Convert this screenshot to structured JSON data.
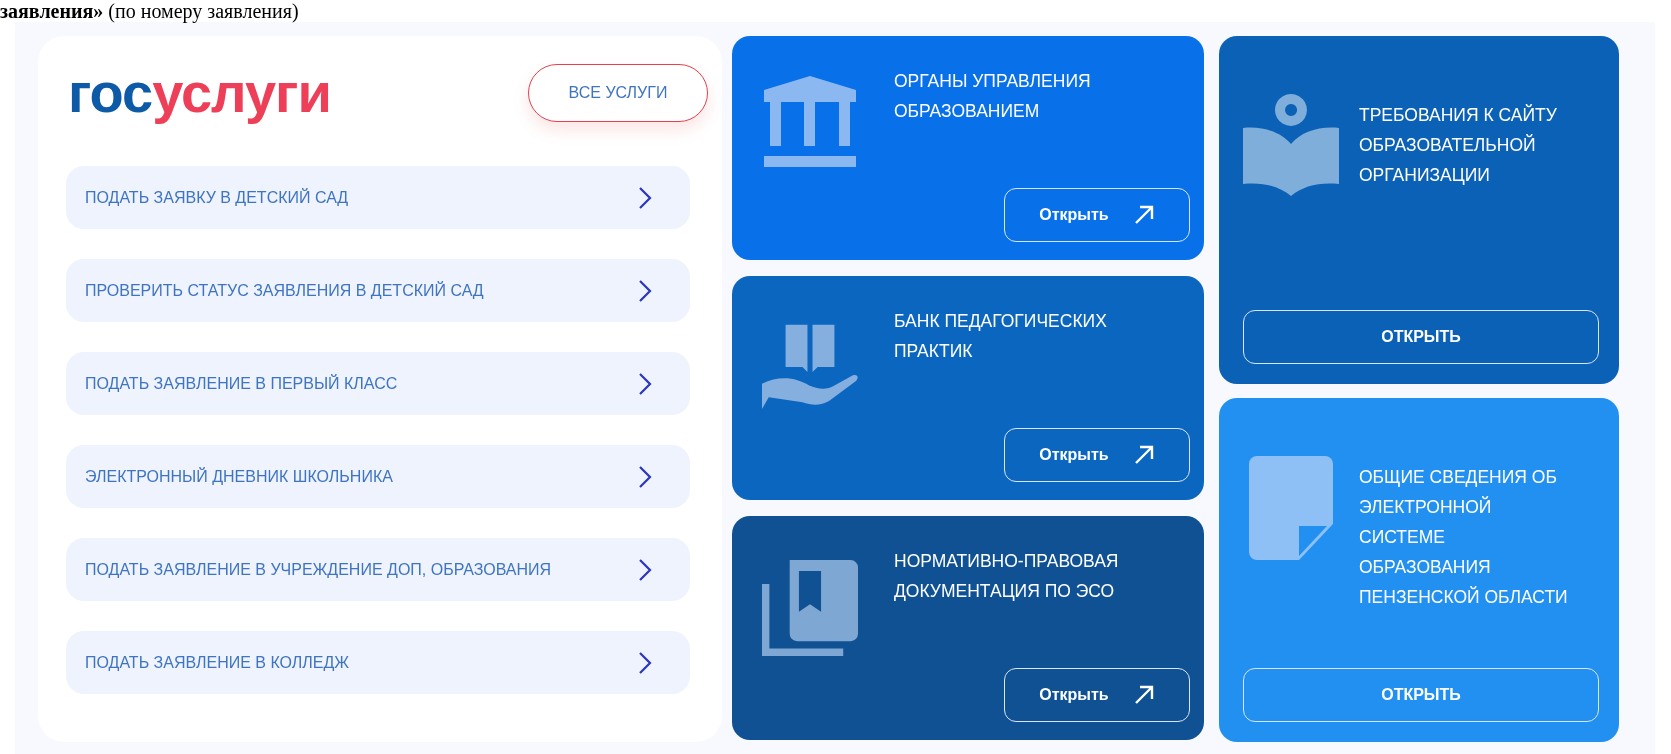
{
  "heading": "**заявления»** (по номеру заявления)",
  "logo": {
    "parts": [
      {
        "text": "гос",
        "color": "#0d5aa7"
      },
      {
        "text": "услуги",
        "color": "#ee3f58"
      }
    ]
  },
  "all_services_button": "ВСЕ УСЛУГИ",
  "services": [
    {
      "label": "ПОДАТЬ ЗАЯВКУ В ДЕТСКИЙ САД"
    },
    {
      "label": "ПРОВЕРИТЬ СТАТУС ЗАЯВЛЕНИЯ В ДЕТСКИЙ САД"
    },
    {
      "label": "ПОДАТЬ ЗАЯВЛЕНИЕ В ПЕРВЫЙ КЛАСС"
    },
    {
      "label": "ЭЛЕКТРОННЫЙ ДНЕВНИК ШКОЛЬНИКА"
    },
    {
      "label": "ПОДАТЬ ЗАЯВЛЕНИЕ В УЧРЕЖДЕНИЕ ДОП, ОБРАЗОВАНИЯ"
    },
    {
      "label": "ПОДАТЬ ЗАЯВЛЕНИЕ В КОЛЛЕДЖ"
    }
  ],
  "columns": [
    {
      "cards": [
        {
          "kind": "bank",
          "color": "#0870e8",
          "lines": [
            "ОРГАНЫ УПРАВЛЕНИЯ",
            "ОБРАЗОВАНИЕМ"
          ],
          "button": {
            "label": "Открыть",
            "arrow": true
          }
        },
        {
          "kind": "book-hand",
          "color": "#0b66c0",
          "lines": [
            "БАНК ПЕДАГОГИЧЕСКИХ",
            "ПРАКТИК"
          ],
          "button": {
            "label": "Открыть",
            "arrow": true
          }
        },
        {
          "kind": "books",
          "color": "#0f5192",
          "lines": [
            "НОРМАТИВНО-ПРАВОВАЯ",
            "ДОКУМЕНТАЦИЯ ПО ЭСО"
          ],
          "button": {
            "label": "Открыть",
            "arrow": true
          }
        }
      ]
    },
    {
      "cards": [
        {
          "kind": "reader",
          "color": "#0b61b5",
          "lines": [
            "ТРЕБОВАНИЯ К САЙТУ",
            "ОБРАЗОВАТЕЛЬНОЙ",
            "ОРГАНИЗАЦИИ"
          ],
          "button": {
            "label": "ОТКРЫТЬ",
            "arrow": false
          }
        },
        {
          "kind": "document",
          "color": "#2190f0",
          "lines": [
            "ОБЩИЕ СВЕДЕНИЯ ОБ",
            "ЭЛЕКТРОННОЙ",
            "СИСТЕМЕ",
            "ОБРАЗОВАНИЯ",
            "ПЕНЗЕНСКОЙ ОБЛАСТИ"
          ],
          "button": {
            "label": "ОТКРЫТЬ",
            "arrow": false
          }
        }
      ]
    }
  ]
}
